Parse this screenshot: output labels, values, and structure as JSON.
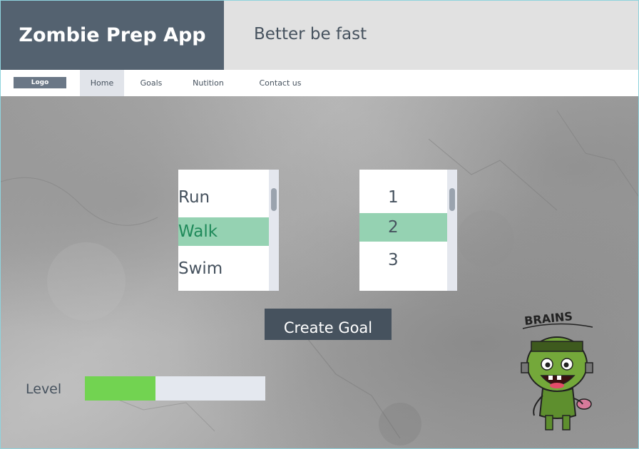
{
  "app": {
    "title": "Zombie Prep App",
    "tagline": "Better be fast"
  },
  "nav": {
    "logo": "Logo",
    "items": [
      {
        "label": "Home",
        "active": true
      },
      {
        "label": "Goals",
        "active": false
      },
      {
        "label": "Nutition",
        "active": false
      },
      {
        "label": "Contact us",
        "active": false
      }
    ]
  },
  "activity_list": {
    "items": [
      "Run",
      "Walk",
      "Swim"
    ],
    "selected": "Walk"
  },
  "quantity_list": {
    "items": [
      "1",
      "2",
      "3"
    ],
    "selected": "2"
  },
  "create_button": {
    "label": "Create Goal"
  },
  "level": {
    "label": "Level",
    "progress": 0.39
  },
  "mascot": {
    "caption": "BRAINS",
    "icon": "zombie-icon"
  },
  "colors": {
    "header_dark": "#546270",
    "header_light": "#e1e1e1",
    "selected_row": "#95d2b2",
    "progress_fill": "#72d351",
    "button": "#46525e"
  }
}
